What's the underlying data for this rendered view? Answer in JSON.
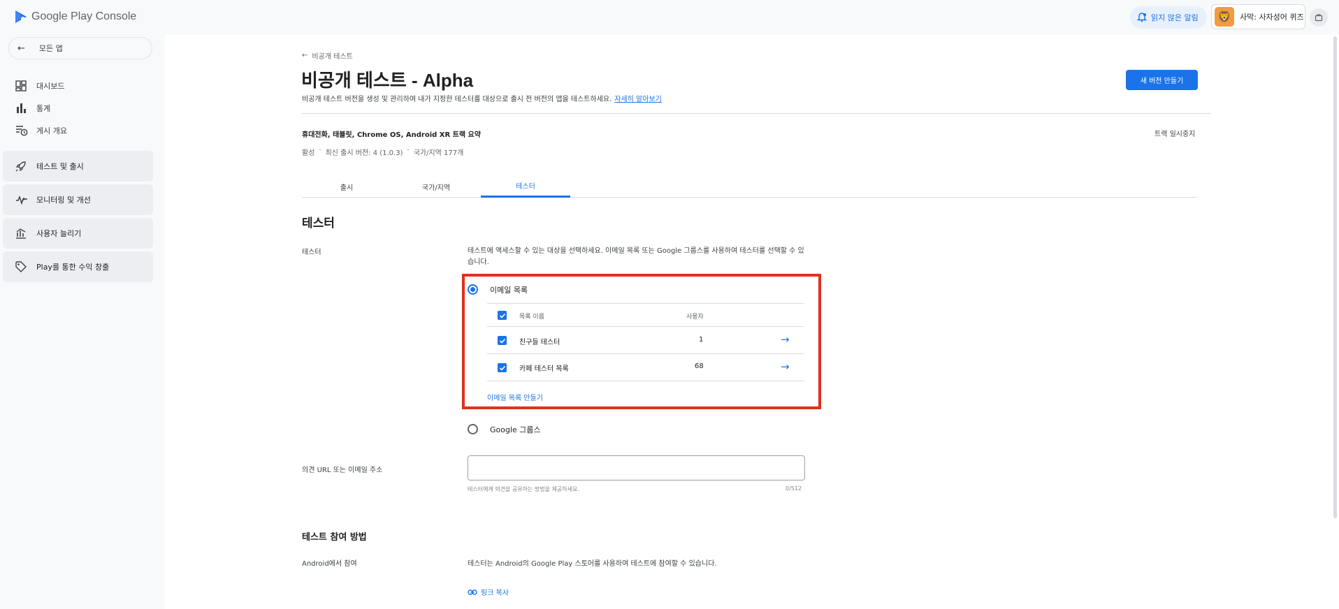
{
  "topbar": {
    "brand": "Google Play Console",
    "notifications_label": "읽지 않은 알림",
    "account_label": "사막: 사자성어 퀴즈"
  },
  "sidebar": {
    "back_label": "모든 앱",
    "items": [
      {
        "label": "대시보드",
        "icon": "dashboard-icon"
      },
      {
        "label": "통계",
        "icon": "bar-chart-icon"
      },
      {
        "label": "게시 개요",
        "icon": "publishing-overview-icon"
      }
    ],
    "groups": [
      {
        "label": "테스트 및 출시",
        "icon": "rocket-icon"
      },
      {
        "label": "모니터링 및 개선",
        "icon": "vitals-icon"
      },
      {
        "label": "사용자 늘리기",
        "icon": "grow-icon"
      },
      {
        "label": "Play를 통한 수익 창출",
        "icon": "tag-icon"
      }
    ]
  },
  "header": {
    "breadcrumb": "비공개 테스트",
    "title": "비공개 테스트 - Alpha",
    "description": "비공개 테스트 버전을 생성 및 관리하여 내가 지정한 테스터를 대상으로 출시 전 버전의 앱을 테스트하세요.",
    "learn_more": "자세히 알아보기",
    "new_release_button": "새 버전 만들기"
  },
  "track": {
    "summary": "휴대전화, 태블릿, Chrome OS, Android XR 트랙 요약",
    "pause": "트랙 일시중지",
    "status": "활성",
    "latest_release": "최신 출시 버전: 4 (1.0.3)",
    "countries": "국가/지역 177개"
  },
  "tabs": [
    "출시",
    "국가/지역",
    "테스터"
  ],
  "active_tab": "테스터",
  "testers": {
    "section_title": "테스터",
    "label": "테스터",
    "help": "테스트에 액세스할 수 있는 대상을 선택하세요. 이메일 목록 또는 Google 그룹스를 사용하여 테스터를 선택할 수 있습니다.",
    "option_email": "이메일 목록",
    "option_groups": "Google 그룹스",
    "table_headers": [
      "목록 이름",
      "사용자"
    ],
    "rows": [
      {
        "name": "친구들 테스터",
        "users": "1"
      },
      {
        "name": "카페 테스터 목록",
        "users": "68"
      }
    ],
    "create_list": "이메일 목록 만들기"
  },
  "feedback": {
    "label": "의견 URL 또는 이메일 주소",
    "value": "",
    "hint": "테스터에게 의견을 공유하는 방법을 제공하세요.",
    "counter": "0/512"
  },
  "join": {
    "title": "테스트 참여 방법",
    "android_label": "Android에서 참여",
    "android_desc": "테스터는 Android의 Google Play 스토어를 사용하여 테스트에 참여할 수 있습니다.",
    "copy_link": "링크 복사"
  },
  "colors": {
    "accent": "#1a73e8",
    "highlight": "#e0301e"
  }
}
